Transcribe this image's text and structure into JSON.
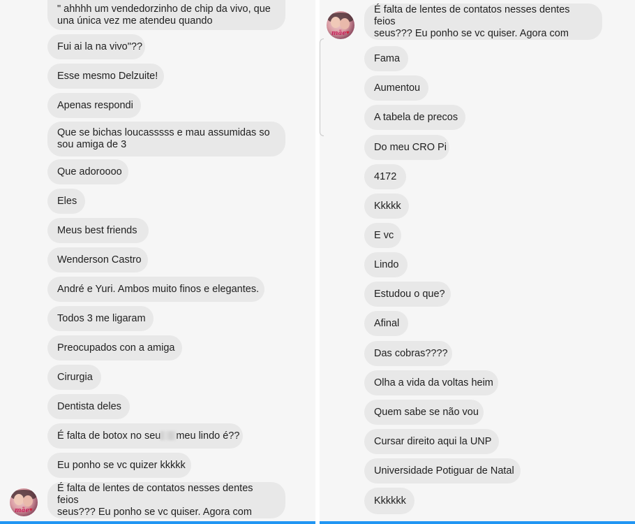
{
  "left_panel": {
    "messages": [
      {
        "line1": "\" ahhhh um vendedorzinho de chip da vivo, que",
        "line2": "una única vez me atendeu quando"
      },
      {
        "text": "Fui ai la na vivo\"??"
      },
      {
        "text": "Esse mesmo Delzuite!"
      },
      {
        "text": "Apenas respondi"
      },
      {
        "line1": "Que se bichas loucasssss e mau assumidas so",
        "line2": "sou amiga de 3"
      },
      {
        "text": "Que adoroooo"
      },
      {
        "text": "Eles"
      },
      {
        "text": "Meus best friends"
      },
      {
        "text": "Wenderson Castro"
      },
      {
        "text": "André e Yuri. Ambos muito finos e elegantes."
      },
      {
        "text": "Todos 3 me ligaram"
      },
      {
        "text": "Preocupados con a amiga"
      },
      {
        "text": "Cirurgia"
      },
      {
        "text": "Dentista deles"
      },
      {
        "before": "É falta de botox no seu",
        "after": "meu lindo é??"
      },
      {
        "text": "Eu ponho se vc quizer kkkkk"
      },
      {
        "line1": "É falta de lentes de contatos nesses dentes feios",
        "line2": "seus??? Eu ponho se vc quiser. Agora com"
      }
    ],
    "avatar_label": "mãe"
  },
  "right_panel": {
    "messages": [
      {
        "line1": "É falta de lentes de contatos nesses dentes feios",
        "line2": "seus??? Eu ponho se vc quiser. Agora com"
      },
      {
        "text": "Fama"
      },
      {
        "text": "Aumentou"
      },
      {
        "text": "A tabela de precos"
      },
      {
        "text": "Do meu CRO Pi"
      },
      {
        "text": "4172"
      },
      {
        "text": "Kkkkk"
      },
      {
        "text": "E vc"
      },
      {
        "text": "Lindo"
      },
      {
        "text": "Estudou o que?"
      },
      {
        "text": "Afinal"
      },
      {
        "text": "Das cobras????"
      },
      {
        "text": "Olha a vida da voltas heim"
      },
      {
        "text": "Quem sabe se não vou"
      },
      {
        "text": "Cursar direito aqui la UNP"
      },
      {
        "text": "Universidade Potiguar de Natal"
      },
      {
        "text": "Kkkkkk"
      }
    ],
    "avatar_label": "mãe"
  },
  "colors": {
    "background": "#f6f6f6",
    "bubble": "#e8e8e8",
    "text": "#1f1f1f",
    "accent_bar": "#2196f3"
  },
  "icons": {
    "avatar": "contact-avatar-photo",
    "redaction": "blurred-word"
  }
}
